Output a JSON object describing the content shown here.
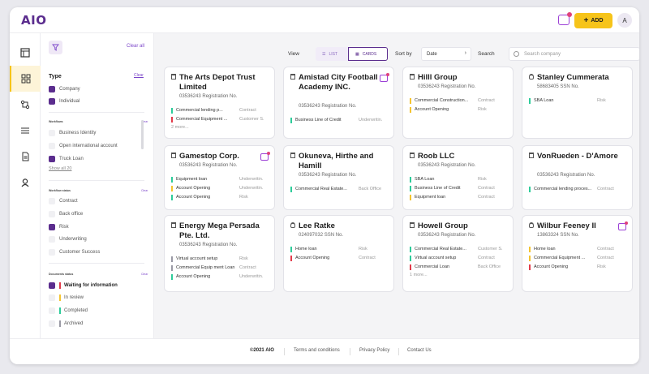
{
  "app": {
    "logo": "AIO"
  },
  "header": {
    "add_label": "ADD",
    "avatar_initial": "A"
  },
  "filters": {
    "clear_all": "Clear all",
    "type": {
      "title": "Type",
      "clear": "Clear",
      "options": [
        {
          "label": "Company",
          "checked": true
        },
        {
          "label": "Individual",
          "checked": true
        }
      ]
    },
    "workflows": {
      "title": "Workflows",
      "clear": "Clear",
      "options": [
        {
          "label": "Business Identity",
          "checked": false
        },
        {
          "label": "Open international account",
          "checked": false
        },
        {
          "label": "Truck Loan",
          "checked": true
        }
      ],
      "show_all": "Show all 20"
    },
    "workflow_status": {
      "title": "Workflow status",
      "clear": "Clear",
      "options": [
        {
          "label": "Contract",
          "checked": false
        },
        {
          "label": "Back office",
          "checked": false
        },
        {
          "label": "Risk",
          "checked": true
        },
        {
          "label": "Underwriting",
          "checked": false
        },
        {
          "label": "Customer Success",
          "checked": false
        }
      ]
    },
    "documents_status": {
      "title": "Documents status",
      "clear": "Clear",
      "options": [
        {
          "label": "Waiting for information",
          "checked": true,
          "color": "#e23b4a"
        },
        {
          "label": "In review",
          "checked": false,
          "color": "#f4c430"
        },
        {
          "label": "Completed",
          "checked": false,
          "color": "#2ecc9a"
        },
        {
          "label": "Archived",
          "checked": false,
          "color": "#9a9aa5"
        }
      ]
    }
  },
  "toolbar": {
    "view_label": "View",
    "list_label": "LIST",
    "cards_label": "CARDS",
    "sort_label": "Sort by",
    "sort_value": "Date",
    "search_label": "Search",
    "search_placeholder": "Search company"
  },
  "cards": [
    {
      "title": "The Arts Depot Trust Limited",
      "reg": "03536243 Registration No.",
      "rows": [
        {
          "name": "Commercial lending p...",
          "status": "Contract",
          "color": "#2ecc9a"
        },
        {
          "name": "Commercial Equipment ...",
          "status": "Customer S.",
          "color": "#e23b4a"
        }
      ],
      "more": "2 more..."
    },
    {
      "title": "Amistad City Football Academy INC.",
      "reg": "03536243 Registration No.",
      "chat": true,
      "rows": [
        {
          "name": "Business Line of Credit",
          "status": "Underwritin.",
          "color": "#2ecc9a"
        }
      ]
    },
    {
      "title": "Hilll Group",
      "reg": "03536243 Registration No.",
      "rows": [
        {
          "name": "Commercial Construction...",
          "status": "Contract",
          "color": "#f4c430"
        },
        {
          "name": "Account Opening",
          "status": "Risk",
          "color": "#f4c430"
        }
      ]
    },
    {
      "title": "Stanley Cummerata",
      "reg": "58683405 SSN No.",
      "person": true,
      "rows": [
        {
          "name": "SBA Loan",
          "status": "Risk",
          "color": "#2ecc9a"
        }
      ]
    },
    {
      "title": "Gamestop Corp.",
      "reg": "03536243 Registration No.",
      "chat": true,
      "rows": [
        {
          "name": "Equipment loan",
          "status": "Underwritin.",
          "color": "#2ecc9a"
        },
        {
          "name": "Account Opening",
          "status": "Underwritin.",
          "color": "#f4c430"
        },
        {
          "name": "Account Opening",
          "status": "Risk",
          "color": "#2ecc9a"
        }
      ]
    },
    {
      "title": "Okuneva, Hirthe and Hamill",
      "reg": "03536243 Registration No.",
      "rows": [
        {
          "name": "Commercial Real Estate...",
          "status": "Back Office",
          "color": "#2ecc9a"
        }
      ]
    },
    {
      "title": "Roob LLC",
      "reg": "03536243 Registration No.",
      "rows": [
        {
          "name": "SBA Loan",
          "status": "Risk",
          "color": "#2ecc9a"
        },
        {
          "name": "Business Line of Credit",
          "status": "Contract",
          "color": "#2ecc9a"
        },
        {
          "name": "Equipment loan",
          "status": "Contract",
          "color": "#f4c430"
        }
      ]
    },
    {
      "title": "VonRueden - D'Amore",
      "reg": "03536243 Registration No.",
      "rows": [
        {
          "name": "Commercial lending proces...",
          "status": "Contract",
          "color": "#2ecc9a"
        }
      ]
    },
    {
      "title": "Energy Mega Persada Pte. Ltd.",
      "reg": "03536243 Registration No.",
      "rows": [
        {
          "name": "Virtual account setup",
          "status": "Risk",
          "color": "#9a9aa5"
        },
        {
          "name": "Commercial Equip ment Loan",
          "status": "Contract",
          "color": "#9a9aa5"
        },
        {
          "name": "Account Opening",
          "status": "Underwritin.",
          "color": "#2ecc9a"
        }
      ]
    },
    {
      "title": "Lee Ratke",
      "reg": "024097032 SSN No.",
      "person": true,
      "rows": [
        {
          "name": "Home loan",
          "status": "Risk",
          "color": "#2ecc9a"
        },
        {
          "name": "Account Opening",
          "status": "Contract",
          "color": "#e23b4a"
        }
      ]
    },
    {
      "title": "Howell Group",
      "reg": "03536243 Registration No.",
      "rows": [
        {
          "name": "Commercial Real Estate...",
          "status": "Customer S.",
          "color": "#2ecc9a"
        },
        {
          "name": "Virtual account setup",
          "status": "Contract",
          "color": "#2ecc9a"
        },
        {
          "name": "Commercial Loan",
          "status": "Back Office",
          "color": "#e23b4a"
        }
      ],
      "more": "1 more..."
    },
    {
      "title": "Wilbur Feeney II",
      "reg": "13863324 SSN No.",
      "person": true,
      "chat": true,
      "rows": [
        {
          "name": "Home loan",
          "status": "Contract",
          "color": "#f4c430"
        },
        {
          "name": "Commercial Equipment ...",
          "status": "Contract",
          "color": "#f4c430"
        },
        {
          "name": "Account Opening",
          "status": "Risk",
          "color": "#e23b4a"
        }
      ]
    }
  ],
  "footer": {
    "copyright": "©2021 AIO",
    "terms": "Terms and conditions",
    "privacy": "Privacy Policy",
    "contact": "Contact Us"
  }
}
